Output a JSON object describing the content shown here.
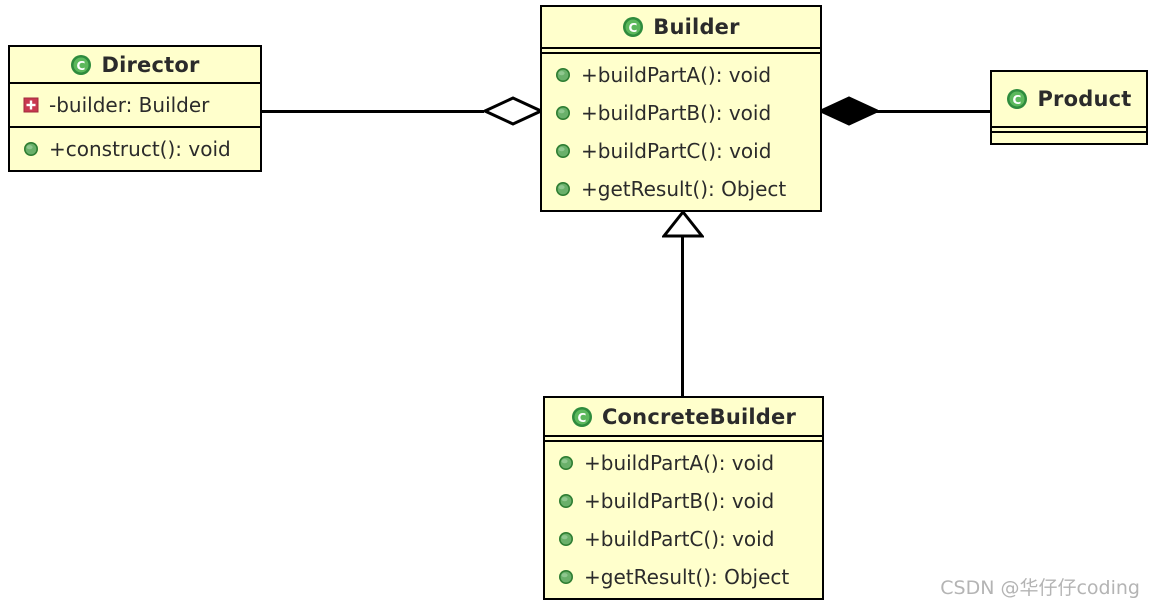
{
  "diagram": {
    "type": "uml-class-diagram",
    "pattern": "Builder",
    "background_color": "#ffffff",
    "class_fill_color": "#ffffcc",
    "class_border_color": "#000000",
    "text_color": "#2b2b2b"
  },
  "classes": {
    "director": {
      "name": "Director",
      "icon": "class-icon",
      "attributes": [
        {
          "label": "-builder: Builder",
          "icon": "private-field-icon",
          "visibility": "private"
        }
      ],
      "methods": [
        {
          "label": "+construct(): void",
          "icon": "public-method-icon",
          "visibility": "public"
        }
      ]
    },
    "builder": {
      "name": "Builder",
      "icon": "class-icon",
      "attributes": [],
      "methods": [
        {
          "label": "+buildPartA(): void",
          "icon": "public-method-icon",
          "visibility": "public"
        },
        {
          "label": "+buildPartB(): void",
          "icon": "public-method-icon",
          "visibility": "public"
        },
        {
          "label": "+buildPartC(): void",
          "icon": "public-method-icon",
          "visibility": "public"
        },
        {
          "label": "+getResult(): Object",
          "icon": "public-method-icon",
          "visibility": "public"
        }
      ]
    },
    "product": {
      "name": "Product",
      "icon": "class-icon",
      "attributes": [],
      "methods": []
    },
    "concrete_builder": {
      "name": "ConcreteBuilder",
      "icon": "class-icon",
      "attributes": [],
      "methods": [
        {
          "label": "+buildPartA(): void",
          "icon": "public-method-icon",
          "visibility": "public"
        },
        {
          "label": "+buildPartB(): void",
          "icon": "public-method-icon",
          "visibility": "public"
        },
        {
          "label": "+buildPartC(): void",
          "icon": "public-method-icon",
          "visibility": "public"
        },
        {
          "label": "+getResult(): Object",
          "icon": "public-method-icon",
          "visibility": "public"
        }
      ]
    }
  },
  "relationships": [
    {
      "id": "director-builder",
      "from": "Director",
      "to": "Builder",
      "kind": "aggregation",
      "marker": "hollow-diamond",
      "marker_at": "Builder"
    },
    {
      "id": "builder-product",
      "from": "Product",
      "to": "Builder",
      "kind": "composition",
      "marker": "filled-diamond",
      "marker_at": "Builder"
    },
    {
      "id": "concretebuilder-builder",
      "from": "ConcreteBuilder",
      "to": "Builder",
      "kind": "generalization",
      "marker": "hollow-triangle",
      "marker_at": "Builder"
    }
  ],
  "watermark": {
    "text": "CSDN @华仔仔coding",
    "color": "#b4b4b4"
  }
}
